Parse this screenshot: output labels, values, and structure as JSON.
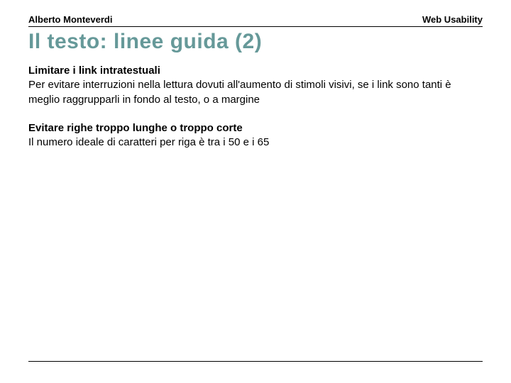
{
  "header": {
    "author": "Alberto Monteverdi",
    "topic": "Web Usability"
  },
  "title": "Il testo: linee guida (2)",
  "sections": [
    {
      "heading": "Limitare i link intratestuali",
      "body": "Per evitare interruzioni nella lettura dovuti all'aumento di stimoli visivi, se i link sono tanti è meglio raggrupparli in fondo al testo, o a margine"
    },
    {
      "heading": "Evitare righe troppo lunghe o troppo corte",
      "body": "Il numero ideale di caratteri per riga è tra i 50 e i 65"
    }
  ]
}
